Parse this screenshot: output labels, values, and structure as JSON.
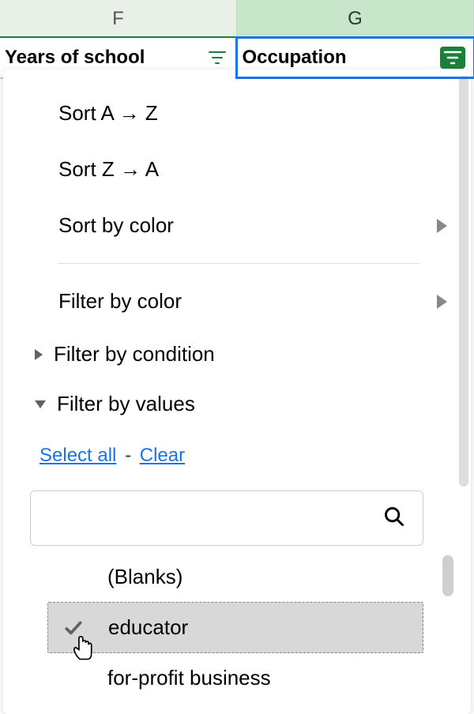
{
  "columns": {
    "f": {
      "letter": "F",
      "header": "Years of school"
    },
    "g": {
      "letter": "G",
      "header": "Occupation"
    }
  },
  "menu": {
    "sortAZ": "Sort A → Z",
    "sortZA": "Sort Z → A",
    "sortColor": "Sort by color",
    "filterColor": "Filter by color",
    "filterCondition": "Filter by condition",
    "filterValues": "Filter by values"
  },
  "links": {
    "selectAll": "Select all",
    "clear": "Clear"
  },
  "values": {
    "blanks": "(Blanks)",
    "educator": "educator",
    "forProfit": "for-profit business"
  }
}
